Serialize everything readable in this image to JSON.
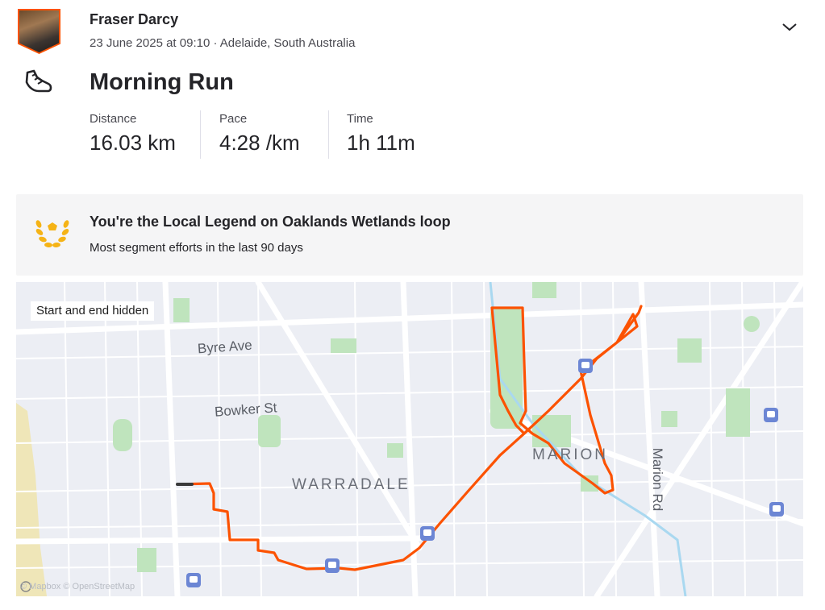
{
  "header": {
    "athlete_name": "Fraser Darcy",
    "meta": "23 June 2025 at 09:10 · Adelaide, South Australia",
    "expand_icon": "chevron-down-icon"
  },
  "activity": {
    "type_icon": "running-shoe-icon",
    "title": "Morning Run",
    "stats": [
      {
        "label": "Distance",
        "value": "16.03 km"
      },
      {
        "label": "Pace",
        "value": "4:28 /km"
      },
      {
        "label": "Time",
        "value": "1h 11m"
      }
    ]
  },
  "local_legend": {
    "icon": "laurel-wreath-icon",
    "title": "You're the Local Legend on Oaklands Wetlands loop",
    "subtitle": "Most segment efforts in the last 90 days"
  },
  "map": {
    "privacy_chip": "Start and end hidden",
    "streets": [
      "Byre Ave",
      "Bowker St",
      "Marion Rd"
    ],
    "suburbs": [
      "WARRADALE",
      "MARION"
    ],
    "attribution": "© Mapbox © OpenStreetMap",
    "route_color": "#fc5200"
  }
}
